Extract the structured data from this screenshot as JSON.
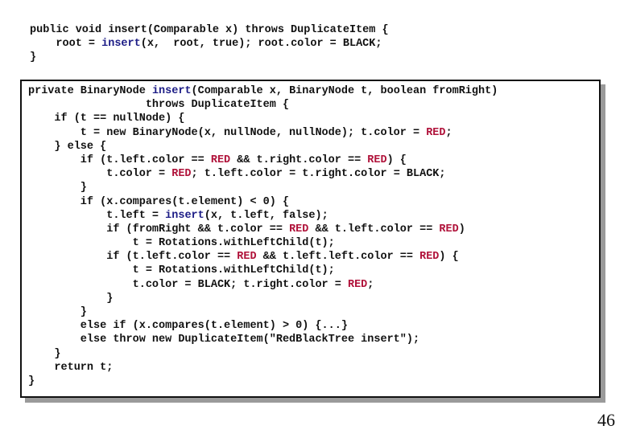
{
  "slide": {
    "page_number": "46",
    "colors": {
      "red_keyword": "#b0123a",
      "blue_method": "#1c1c86",
      "text": "#111111",
      "box_border": "#111111",
      "box_shadow": "#9a9a9a"
    },
    "public_method": {
      "lines": [
        [
          {
            "t": "public void insert(Comparable x) throws DuplicateItem {"
          }
        ],
        [
          {
            "t": "    root = "
          },
          {
            "t": "insert",
            "c": "blue"
          },
          {
            "t": "(x,  root, true); root.color = BLACK;"
          }
        ],
        [
          {
            "t": "}"
          }
        ]
      ]
    },
    "private_method": {
      "lines": [
        [
          {
            "t": "private BinaryNode "
          },
          {
            "t": "insert",
            "c": "blue"
          },
          {
            "t": "(Comparable x, BinaryNode t, boolean fromRight)"
          }
        ],
        [
          {
            "t": "                  throws DuplicateItem {"
          }
        ],
        [
          {
            "t": "    if (t == nullNode) {"
          }
        ],
        [
          {
            "t": "        t = new BinaryNode(x, nullNode, nullNode); t.color = "
          },
          {
            "t": "RED",
            "c": "red"
          },
          {
            "t": ";"
          }
        ],
        [
          {
            "t": "    } else {"
          }
        ],
        [
          {
            "t": "        if (t.left.color == "
          },
          {
            "t": "RED",
            "c": "red"
          },
          {
            "t": " && t.right.color == "
          },
          {
            "t": "RED",
            "c": "red"
          },
          {
            "t": ") {"
          }
        ],
        [
          {
            "t": "            t.color = "
          },
          {
            "t": "RED",
            "c": "red"
          },
          {
            "t": "; t.left.color = t.right.color = BLACK;"
          }
        ],
        [
          {
            "t": "        }"
          }
        ],
        [
          {
            "t": "        if (x.compares(t.element) < 0) {"
          }
        ],
        [
          {
            "t": "            t.left = "
          },
          {
            "t": "insert",
            "c": "blue"
          },
          {
            "t": "(x, t.left, false);"
          }
        ],
        [
          {
            "t": "            if (fromRight && t.color == "
          },
          {
            "t": "RED",
            "c": "red"
          },
          {
            "t": " && t.left.color == "
          },
          {
            "t": "RED",
            "c": "red"
          },
          {
            "t": ")"
          }
        ],
        [
          {
            "t": "                t = Rotations.withLeftChild(t);"
          }
        ],
        [
          {
            "t": "            if (t.left.color == "
          },
          {
            "t": "RED",
            "c": "red"
          },
          {
            "t": " && t.left.left.color == "
          },
          {
            "t": "RED",
            "c": "red"
          },
          {
            "t": ") {"
          }
        ],
        [
          {
            "t": "                t = Rotations.withLeftChild(t);"
          }
        ],
        [
          {
            "t": "                t.color = BLACK; t.right.color = "
          },
          {
            "t": "RED",
            "c": "red"
          },
          {
            "t": ";"
          }
        ],
        [
          {
            "t": "            }"
          }
        ],
        [
          {
            "t": "        }"
          }
        ],
        [
          {
            "t": "        else if (x.compares(t.element) > 0) {...}"
          }
        ],
        [
          {
            "t": "        else throw new DuplicateItem(\"RedBlackTree insert\");"
          }
        ],
        [
          {
            "t": "    }"
          }
        ],
        [
          {
            "t": "    return t;"
          }
        ],
        [
          {
            "t": "}"
          }
        ]
      ]
    }
  }
}
